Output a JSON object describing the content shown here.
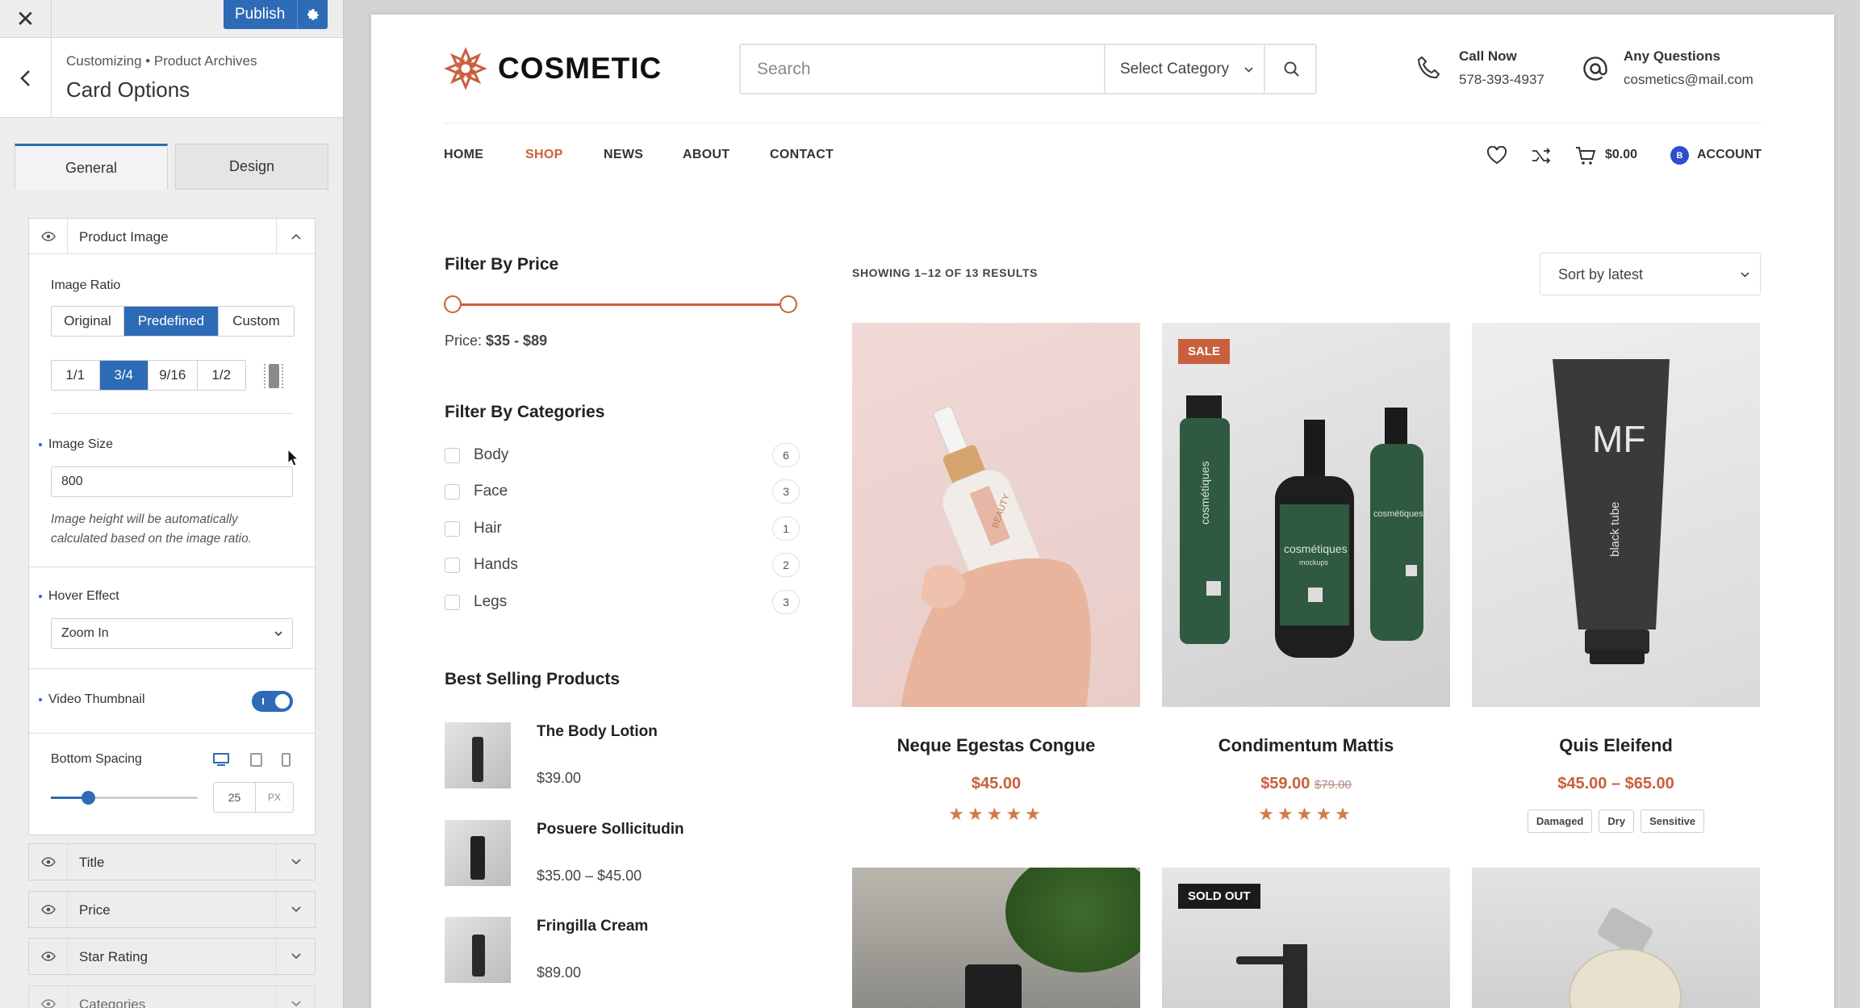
{
  "customizer": {
    "close": "✕",
    "publish": "Publish",
    "breadcrumb": "Customizing • Product Archives",
    "title": "Card Options",
    "tabs": [
      "General",
      "Design"
    ],
    "product_image": {
      "header": "Product Image",
      "image_ratio_label": "Image Ratio",
      "ratio_modes": [
        "Original",
        "Predefined",
        "Custom"
      ],
      "ratio_mode_active": "Predefined",
      "ratios": [
        "1/1",
        "3/4",
        "9/16",
        "1/2"
      ],
      "ratio_active": "3/4",
      "image_size_label": "Image Size",
      "image_size_value": "800",
      "image_size_help_1": "Image height will be automatically",
      "image_size_help_2": "calculated based on the image ratio.",
      "hover_effect_label": "Hover Effect",
      "hover_effect_value": "Zoom In",
      "video_thumbnail_label": "Video Thumbnail",
      "video_thumbnail_on": true,
      "bottom_spacing_label": "Bottom Spacing",
      "bottom_spacing_value": "25",
      "bottom_spacing_unit": "PX",
      "bottom_spacing_slider_fraction": 0.25
    },
    "collapsed_sections": [
      "Title",
      "Price",
      "Star Rating",
      "Categories"
    ]
  },
  "site": {
    "logo": "COSMETIC",
    "search_placeholder": "Search",
    "category_select": "Select Category",
    "call_label": "Call Now",
    "call_value": "578-393-4937",
    "questions_label": "Any Questions",
    "questions_value": "cosmetics@mail.com",
    "nav": [
      "HOME",
      "SHOP",
      "NEWS",
      "ABOUT",
      "CONTACT"
    ],
    "nav_active": "SHOP",
    "cart_total": "$0.00",
    "account": "ACCOUNT",
    "accent": "#c9603d"
  },
  "filters": {
    "price_title": "Filter By Price",
    "price_prefix": "Price:",
    "price_range": "$35 - $89",
    "categories_title": "Filter By Categories",
    "categories": [
      {
        "name": "Body",
        "count": "6"
      },
      {
        "name": "Face",
        "count": "3"
      },
      {
        "name": "Hair",
        "count": "1"
      },
      {
        "name": "Hands",
        "count": "2"
      },
      {
        "name": "Legs",
        "count": "3"
      }
    ],
    "best_title": "Best Selling Products",
    "best": [
      {
        "name": "The Body Lotion",
        "price": "$39.00"
      },
      {
        "name": "Posuere Sollicitudin",
        "price": "$35.00 – $45.00"
      },
      {
        "name": "Fringilla Cream",
        "price": "$89.00"
      }
    ]
  },
  "results": {
    "showing": "SHOWING 1–12 OF 13 RESULTS",
    "sort": "Sort by latest",
    "products": [
      {
        "title": "Neque Egestas Congue",
        "price": "$45.00",
        "old_price": "",
        "badge": "",
        "stars": "★★★★★"
      },
      {
        "title": "Condimentum Mattis",
        "price": "$59.00",
        "old_price": "$79.00",
        "badge": "SALE",
        "stars": "★★★★★"
      },
      {
        "title": "Quis Eleifend",
        "price": "$45.00 – $65.00",
        "old_price": "",
        "badge": "",
        "tags": [
          "Damaged",
          "Dry",
          "Sensitive"
        ]
      }
    ],
    "row2_badge": "SOLD OUT",
    "bottle_text_1": "cosmétiques",
    "bottle_text_2": "mockups",
    "tube_logo": "MF",
    "tube_text": "black tube",
    "serum_label": "BEAUTY"
  }
}
